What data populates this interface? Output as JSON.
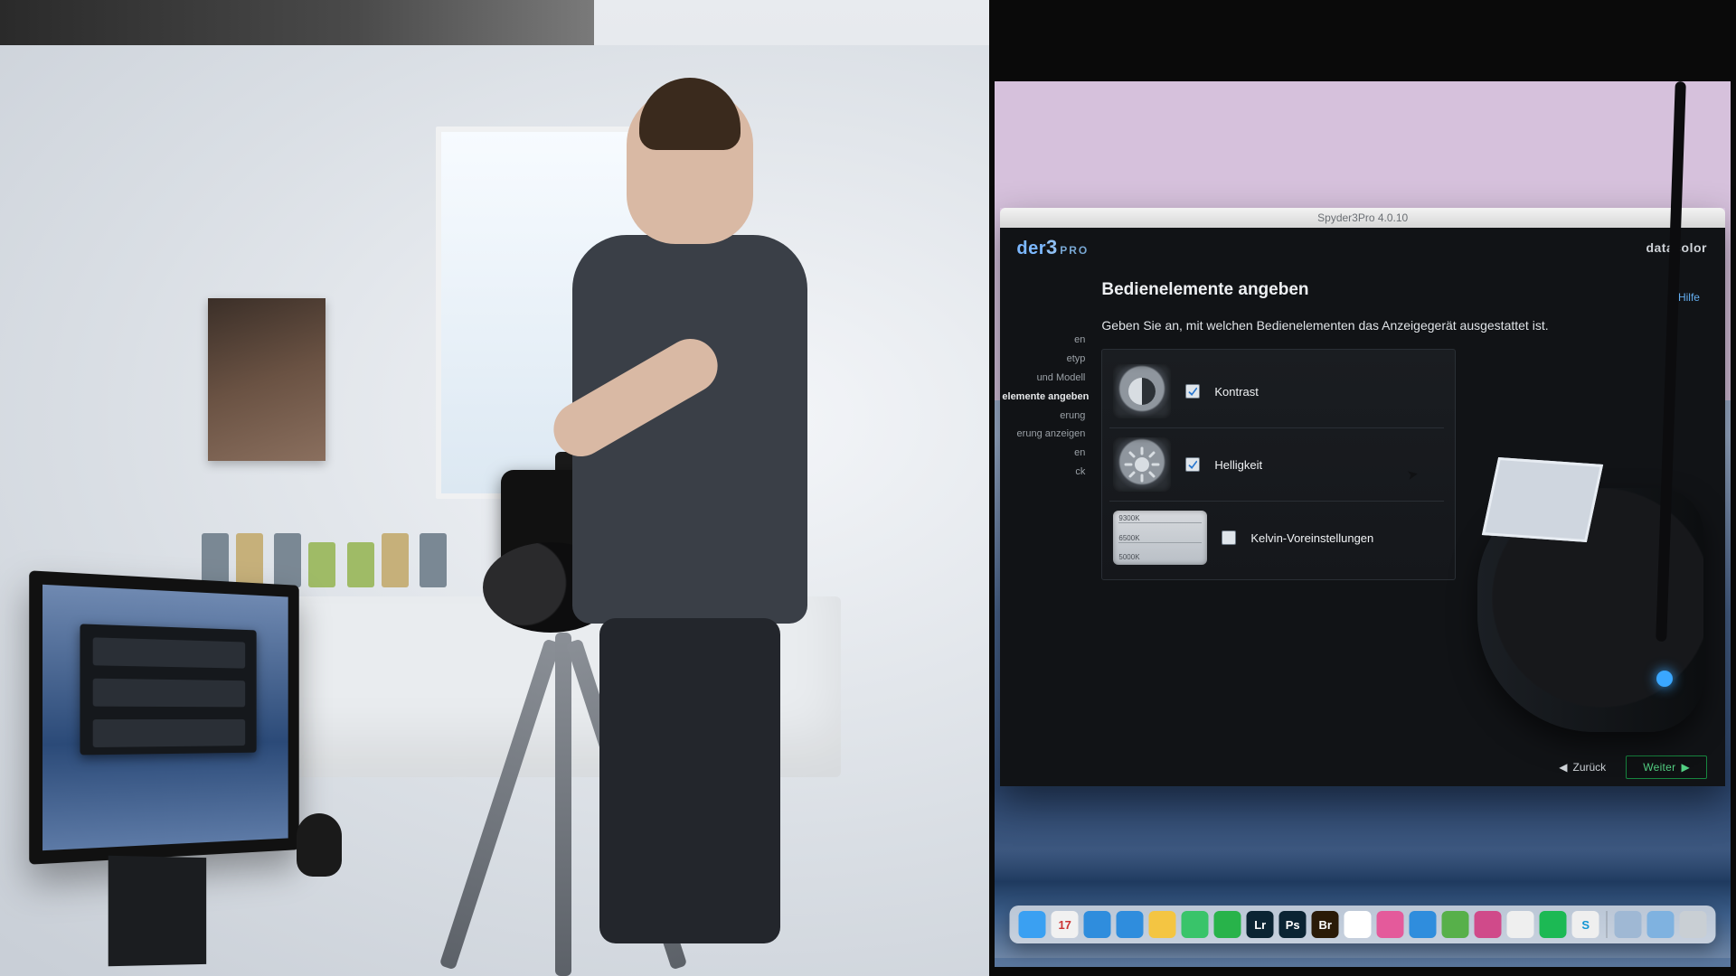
{
  "left_scene": {
    "description": "photo-studio-scene",
    "monitor_mirrors_app": true
  },
  "window": {
    "title": "Spyder3Pro 4.0.10"
  },
  "brand": {
    "product_prefix": "der",
    "product_number": "3",
    "product_suffix": "PRO",
    "company": "datacolor",
    "company_suffix": ""
  },
  "help": {
    "label": "? Hilfe"
  },
  "sidebar": {
    "items": [
      {
        "label": "en",
        "active": false
      },
      {
        "label": "etyp",
        "active": false
      },
      {
        "label": "und Modell",
        "active": false
      },
      {
        "label": "elemente angeben",
        "active": true
      },
      {
        "label": "erung",
        "active": false
      },
      {
        "label": "erung anzeigen",
        "active": false
      },
      {
        "label": "en",
        "active": false
      },
      {
        "label": "ck",
        "active": false
      }
    ]
  },
  "page": {
    "heading": "Bedienelemente angeben",
    "lead": "Geben Sie an, mit welchen Bedienelementen das Anzeigegerät ausgestattet ist."
  },
  "controls": [
    {
      "key": "kontrast",
      "label": "Kontrast",
      "checked": true,
      "icon": "contrast"
    },
    {
      "key": "helligkeit",
      "label": "Helligkeit",
      "checked": true,
      "icon": "brightness"
    },
    {
      "key": "kelvin",
      "label": "Kelvin-Voreinstellungen",
      "checked": false,
      "icon": "kelvin",
      "presets": [
        "9300K",
        "6500K",
        "5000K"
      ]
    }
  ],
  "nav": {
    "back": "Zurück",
    "next": "Weiter"
  },
  "dock": {
    "apps": [
      {
        "name": "finder",
        "bg": "#3aa0f2"
      },
      {
        "name": "calendar",
        "bg": "#f1f1f1",
        "text": "17",
        "fg": "#c33"
      },
      {
        "name": "safari",
        "bg": "#2f8ddd"
      },
      {
        "name": "mail",
        "bg": "#2f8ddd"
      },
      {
        "name": "chrome",
        "bg": "#f4c542"
      },
      {
        "name": "messages",
        "bg": "#39c46a"
      },
      {
        "name": "whatsapp",
        "bg": "#28b34a"
      },
      {
        "name": "lightroom",
        "bg": "#0b2433",
        "text": "Lr"
      },
      {
        "name": "photoshop",
        "bg": "#0b2433",
        "text": "Ps"
      },
      {
        "name": "bridge",
        "bg": "#2a1a07",
        "text": "Br"
      },
      {
        "name": "photos",
        "bg": "#ffffff"
      },
      {
        "name": "itunes",
        "bg": "#e45a9b"
      },
      {
        "name": "appstore",
        "bg": "#2f8ddd"
      },
      {
        "name": "evernote",
        "bg": "#57b04a"
      },
      {
        "name": "instagram",
        "bg": "#d04a8a"
      },
      {
        "name": "slack",
        "bg": "#efefef"
      },
      {
        "name": "spotify",
        "bg": "#1cb954"
      },
      {
        "name": "skype",
        "bg": "#efefef",
        "text": "S",
        "fg": "#1296d4"
      }
    ],
    "right": [
      {
        "name": "downloads",
        "bg": "#9fb8d4"
      },
      {
        "name": "folder",
        "bg": "#7fb2e0"
      },
      {
        "name": "trash",
        "bg": "#c9cfd4"
      }
    ]
  }
}
